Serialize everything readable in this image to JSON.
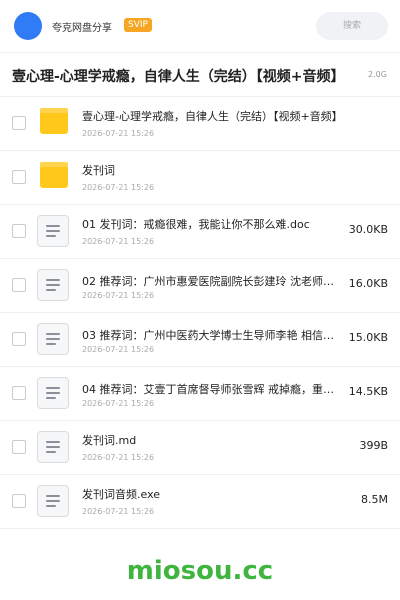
{
  "header": {
    "app_name": "夸克网盘分享",
    "badge": "SVIP",
    "search_label": "搜索"
  },
  "folder": {
    "title": "壹心理-心理学戒瘾，自律人生（完结）【视频+音频】",
    "size": "2.0G"
  },
  "files": [
    {
      "name": "壹心理-心理学戒瘾，自律人生（完结）【视频+音频】",
      "date": "2026-07-21 15:26",
      "size": "",
      "icon": "folder-icon"
    },
    {
      "name": "发刊词",
      "date": "2026-07-21 15:26",
      "size": "",
      "icon": "folder-icon"
    },
    {
      "name": "01 发刊词：戒瘾很难，我能让你不那么难.doc",
      "date": "2026-07-21 15:26",
      "size": "30.0KB",
      "icon": "document-icon"
    },
    {
      "name": "02 推荐词：广州市惠爱医院副院长彭建玲 沈老师…",
      "date": "2026-07-21 15:26",
      "size": "16.0KB",
      "icon": "document-icon"
    },
    {
      "name": "03 推荐词：广州中医药大学博士生导师李艳 相信…",
      "date": "2026-07-21 15:26",
      "size": "15.0KB",
      "icon": "document-icon"
    },
    {
      "name": "04 推荐词：艾壹丁首席督导师张雪辉 戒掉瘾，重…",
      "date": "2026-07-21 15:26",
      "size": "14.5KB",
      "icon": "document-icon"
    },
    {
      "name": "发刊词.md",
      "date": "2026-07-21 15:26",
      "size": "399B",
      "icon": "document-icon"
    },
    {
      "name": "发刊词音频.exe",
      "date": "2026-07-21 15:26",
      "size": "8.5M",
      "icon": "document-icon"
    }
  ],
  "watermark": "miosou.cc",
  "colors": {
    "accent": "#2f7cf6",
    "badge": "#f6a623",
    "folder": "#ffc81a",
    "watermark": "#3fb53f"
  }
}
